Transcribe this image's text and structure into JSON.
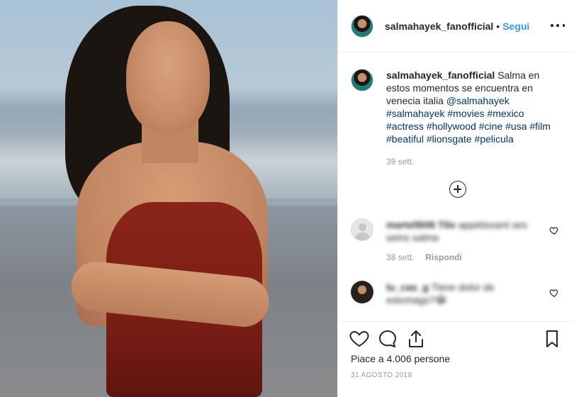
{
  "post": {
    "username": "salmahayek_fanofficial",
    "separator": "•",
    "follow_label": "Segui",
    "caption": {
      "username": "salmahayek_fanofficial",
      "text": "Salma en estos momentos se encuentra en venecia italia",
      "mention": "@salmahayek",
      "hashtags": [
        "#salmahayek",
        "#movies",
        "#mexico",
        "#actress",
        "#hollywood",
        "#cine",
        "#usa",
        "#film",
        "#beatiful",
        "#lionsgate",
        "#pelicula"
      ],
      "time": "39 sett."
    },
    "comments": [
      {
        "username": "martell606 Tilo",
        "text": "appétissant ses seins salma",
        "time": "38 sett.",
        "reply_label": "Rispondi"
      },
      {
        "username": "lu_cas_g",
        "text": "Tiene dolor de estomago?😂"
      }
    ],
    "likes": "Piace a 4.006 persone",
    "date": "31 AGOSTO 2018"
  },
  "icons": {
    "more": "more-options-icon",
    "load_more": "plus-circle-icon",
    "like": "heart-icon",
    "comment": "comment-icon",
    "share": "share-icon",
    "save": "bookmark-icon",
    "comment_like": "heart-icon"
  },
  "colors": {
    "accent": "#3897f0",
    "link": "#003569",
    "text": "#262626",
    "muted": "#999999",
    "border": "#efefef"
  }
}
